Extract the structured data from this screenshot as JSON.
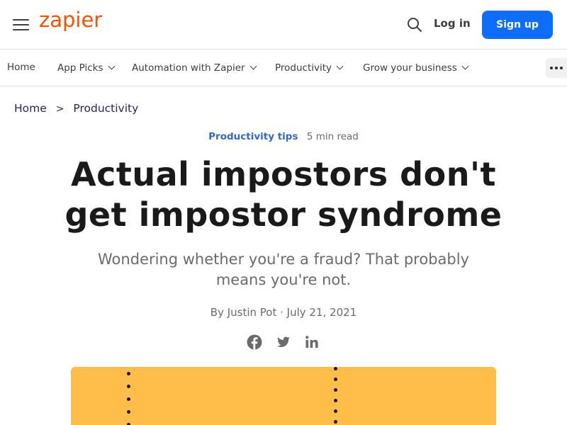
{
  "header": {
    "logo_text": "zapier",
    "logo_color": "#ff4f00",
    "menu_icon": "hamburger-menu-icon",
    "search_icon": "search-icon",
    "login_label": "Log in",
    "signup_label": "Sign up",
    "signup_color": "#0d6efd"
  },
  "nav": {
    "items": [
      {
        "label": "Home",
        "has_dropdown": false
      },
      {
        "label": "App Picks",
        "has_dropdown": true
      },
      {
        "label": "Automation with Zapier",
        "has_dropdown": true
      },
      {
        "label": "Productivity",
        "has_dropdown": true
      },
      {
        "label": "Grow your business",
        "has_dropdown": true
      }
    ],
    "more_icon": "more-dots-icon"
  },
  "breadcrumb": {
    "items": [
      "Home",
      "Productivity"
    ],
    "separator": ">"
  },
  "article": {
    "category": "Productivity tips",
    "category_color": "#3367d6",
    "read_time": "5 min read",
    "title": "Actual impostors don't get impostor syndrome",
    "subtitle": "Wondering whether you're a fraud? That probably means you're not.",
    "byline": "By Justin Pot · July 21, 2021",
    "share_icons": [
      "facebook-icon",
      "twitter-icon",
      "linkedin-icon"
    ],
    "hero_background": "#ffbd49"
  }
}
